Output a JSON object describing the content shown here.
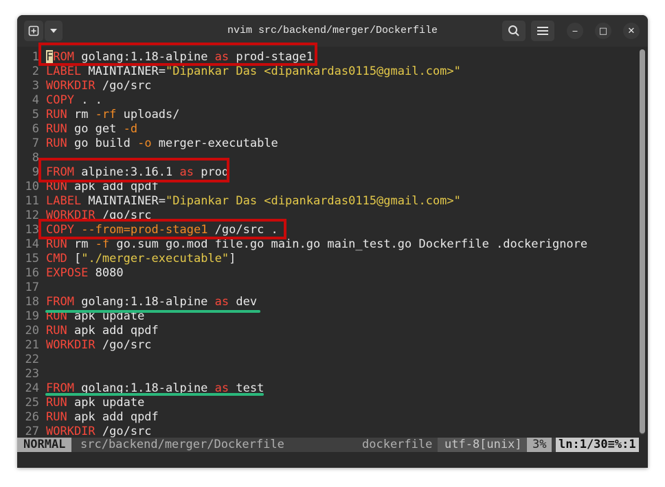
{
  "window": {
    "title": "nvim src/backend/merger/Dockerfile",
    "new_tab_icon": "plus-box-icon",
    "menu_icon": "chevron-down-icon",
    "search_icon": "search-icon",
    "hamburger_icon": "hamburger-icon",
    "minimize_label": "‒",
    "maximize_label": "□",
    "close_label": "✕"
  },
  "editor": {
    "lines": [
      {
        "n": "1",
        "segs": [
          {
            "t": "F",
            "c": "cursor"
          },
          {
            "t": "ROM",
            "c": "kw"
          },
          {
            "t": " golang:1.18-alpine ",
            "c": ""
          },
          {
            "t": "as",
            "c": "kw"
          },
          {
            "t": " prod-stage1",
            "c": ""
          }
        ]
      },
      {
        "n": "2",
        "segs": [
          {
            "t": "LABEL",
            "c": "kw"
          },
          {
            "t": " MAINTAINER=",
            "c": ""
          },
          {
            "t": "\"Dipankar Das <dipankardas0115@gmail.com>\"",
            "c": "str"
          }
        ]
      },
      {
        "n": "3",
        "segs": [
          {
            "t": "WORKDIR",
            "c": "kw"
          },
          {
            "t": " /go/src",
            "c": ""
          }
        ]
      },
      {
        "n": "4",
        "segs": [
          {
            "t": "COPY",
            "c": "kw"
          },
          {
            "t": " . .",
            "c": ""
          }
        ]
      },
      {
        "n": "5",
        "segs": [
          {
            "t": "RUN",
            "c": "kw"
          },
          {
            "t": " rm ",
            "c": ""
          },
          {
            "t": "-rf",
            "c": "opt"
          },
          {
            "t": " uploads/",
            "c": ""
          }
        ]
      },
      {
        "n": "6",
        "segs": [
          {
            "t": "RUN",
            "c": "kw"
          },
          {
            "t": " go get ",
            "c": ""
          },
          {
            "t": "-d",
            "c": "opt"
          }
        ]
      },
      {
        "n": "7",
        "segs": [
          {
            "t": "RUN",
            "c": "kw"
          },
          {
            "t": " go build ",
            "c": ""
          },
          {
            "t": "-o",
            "c": "opt"
          },
          {
            "t": " merger-executable",
            "c": ""
          }
        ]
      },
      {
        "n": "8",
        "segs": []
      },
      {
        "n": "9",
        "segs": [
          {
            "t": "FROM",
            "c": "kw"
          },
          {
            "t": " alpine:3.16.1 ",
            "c": ""
          },
          {
            "t": "as",
            "c": "kw"
          },
          {
            "t": " prod",
            "c": ""
          }
        ]
      },
      {
        "n": "10",
        "segs": [
          {
            "t": "RUN",
            "c": "kw"
          },
          {
            "t": " apk add qpdf",
            "c": ""
          }
        ]
      },
      {
        "n": "11",
        "segs": [
          {
            "t": "LABEL",
            "c": "kw"
          },
          {
            "t": " MAINTAINER=",
            "c": ""
          },
          {
            "t": "\"Dipankar Das <dipankardas0115@gmail.com>\"",
            "c": "str"
          }
        ]
      },
      {
        "n": "12",
        "segs": [
          {
            "t": "WORKDIR",
            "c": "kw"
          },
          {
            "t": " /go/src",
            "c": ""
          }
        ]
      },
      {
        "n": "13",
        "segs": [
          {
            "t": "COPY",
            "c": "kw"
          },
          {
            "t": " ",
            "c": ""
          },
          {
            "t": "--from=prod-stage1",
            "c": "opt"
          },
          {
            "t": " /go/src .",
            "c": ""
          }
        ]
      },
      {
        "n": "14",
        "segs": [
          {
            "t": "RUN",
            "c": "kw"
          },
          {
            "t": " rm ",
            "c": ""
          },
          {
            "t": "-f",
            "c": "opt"
          },
          {
            "t": " go.sum go.mod file.go main.go main_test.go Dockerfile .dockerignore",
            "c": ""
          }
        ]
      },
      {
        "n": "15",
        "segs": [
          {
            "t": "CMD",
            "c": "kw"
          },
          {
            "t": " [",
            "c": ""
          },
          {
            "t": "\"./merger-executable\"",
            "c": "str"
          },
          {
            "t": "]",
            "c": ""
          }
        ]
      },
      {
        "n": "16",
        "segs": [
          {
            "t": "EXPOSE",
            "c": "kw"
          },
          {
            "t": " 8080",
            "c": ""
          }
        ]
      },
      {
        "n": "17",
        "segs": []
      },
      {
        "n": "18",
        "segs": [
          {
            "t": "FROM",
            "c": "kw"
          },
          {
            "t": " golang:1.18-alpine ",
            "c": ""
          },
          {
            "t": "as",
            "c": "kw"
          },
          {
            "t": " dev",
            "c": ""
          }
        ]
      },
      {
        "n": "19",
        "segs": [
          {
            "t": "RUN",
            "c": "kw"
          },
          {
            "t": " apk update",
            "c": ""
          }
        ]
      },
      {
        "n": "20",
        "segs": [
          {
            "t": "RUN",
            "c": "kw"
          },
          {
            "t": " apk add qpdf",
            "c": ""
          }
        ]
      },
      {
        "n": "21",
        "segs": [
          {
            "t": "WORKDIR",
            "c": "kw"
          },
          {
            "t": " /go/src",
            "c": ""
          }
        ]
      },
      {
        "n": "22",
        "segs": []
      },
      {
        "n": "23",
        "segs": []
      },
      {
        "n": "24",
        "segs": [
          {
            "t": "FROM",
            "c": "kw"
          },
          {
            "t": " golang:1.18-alpine ",
            "c": ""
          },
          {
            "t": "as",
            "c": "kw"
          },
          {
            "t": " test",
            "c": ""
          }
        ]
      },
      {
        "n": "25",
        "segs": [
          {
            "t": "RUN",
            "c": "kw"
          },
          {
            "t": " apk update",
            "c": ""
          }
        ]
      },
      {
        "n": "26",
        "segs": [
          {
            "t": "RUN",
            "c": "kw"
          },
          {
            "t": " apk add qpdf",
            "c": ""
          }
        ]
      },
      {
        "n": "27",
        "segs": [
          {
            "t": "WORKDIR",
            "c": "kw"
          },
          {
            "t": " /go/src",
            "c": ""
          }
        ]
      }
    ]
  },
  "statusline": {
    "mode": "NORMAL",
    "file": "src/backend/merger/Dockerfile",
    "filetype": "dockerfile",
    "encoding": "utf-8[unix]",
    "percent": "3%",
    "position": "ln:1/30≡%:1"
  },
  "colors": {
    "keyword": "#f6483b",
    "string": "#e4c94a",
    "option": "#f28b26",
    "highlight_box": "#c80a0a",
    "underline": "#2bb87c"
  }
}
